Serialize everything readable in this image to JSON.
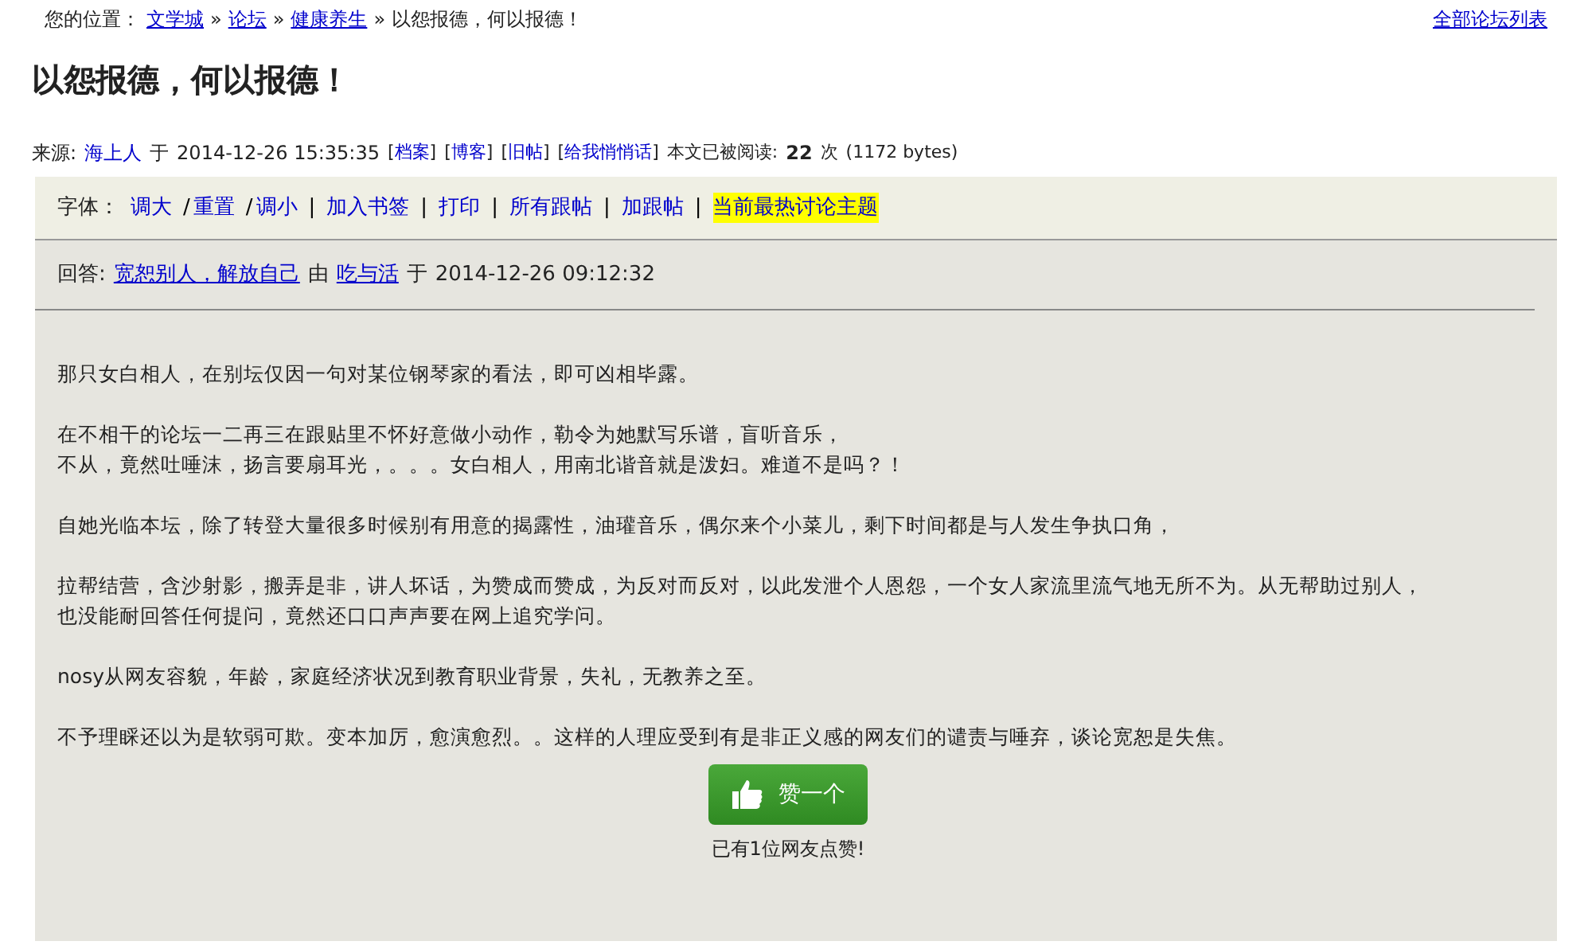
{
  "breadcrumb": {
    "label": "您的位置：",
    "links": [
      {
        "text": "文学城"
      },
      {
        "text": "论坛"
      },
      {
        "text": "健康养生"
      }
    ],
    "separator": "»",
    "current": "以怨报德，何以报德！",
    "right_link": "全部论坛列表"
  },
  "title": "以怨报德，何以报德！",
  "meta": {
    "source_label": "来源:",
    "author": "海上人",
    "at": "于",
    "datetime": "2014-12-26 15:35:35",
    "links": [
      "档案",
      "博客",
      "旧帖",
      "给我悄悄话"
    ],
    "bracket_open": "[",
    "bracket_close": "]",
    "read_label": "本文已被阅读:",
    "read_count": "22",
    "read_unit": "次",
    "size": "(1172 bytes)"
  },
  "toolbar": {
    "font_label": "字体：",
    "font_links": [
      "调大",
      "重置",
      "调小"
    ],
    "font_separator": "/",
    "separator": "|",
    "links": [
      {
        "text": "加入书签",
        "highlighted": false
      },
      {
        "text": "打印",
        "highlighted": false
      },
      {
        "text": "所有跟帖",
        "highlighted": false
      },
      {
        "text": "加跟帖",
        "highlighted": false
      },
      {
        "text": "当前最热讨论主题",
        "highlighted": true
      }
    ]
  },
  "reply": {
    "label": "回答:",
    "topic": "宽恕别人，解放自己",
    "by": "由",
    "author": "吃与活",
    "at": "于",
    "datetime": "2014-12-26 09:12:32"
  },
  "paragraphs": [
    [
      "那只女白相人，在别坛仅因一句对某位钢琴家的看法，即可凶相毕露。"
    ],
    [
      "在不相干的论坛一二再三在跟贴里不怀好意做小动作，勒令为她默写乐谱，盲听音乐，",
      "不从，竟然吐唾沫，扬言要扇耳光，。。。女白相人，用南北谐音就是泼妇。难道不是吗？！"
    ],
    [
      "自她光临本坛，除了转登大量很多时候别有用意的揭露性，油瓘音乐，偶尔来个小菜儿，剩下时间都是与人发生争执口角，"
    ],
    [
      "拉帮结营，含沙射影，搬弄是非，讲人坏话，为赞成而赞成，为反对而反对，以此发泄个人恩怨，一个女人家流里流气地无所不为。从无帮助过别人，",
      "也没能耐回答任何提问，竟然还口口声声要在网上追究学问。"
    ],
    [
      "nosy从网友容貌，年龄，家庭经济状况到教育职业背景，失礼，无教养之至。"
    ],
    [
      "不予理睬还以为是软弱可欺。变本加厉，愈演愈烈。。这样的人理应受到有是非正义感的网友们的谴责与唾弃，谈论宽恕是失焦。"
    ]
  ],
  "like": {
    "button": "赞一个",
    "count_text": "已有1位网友点赞!"
  }
}
